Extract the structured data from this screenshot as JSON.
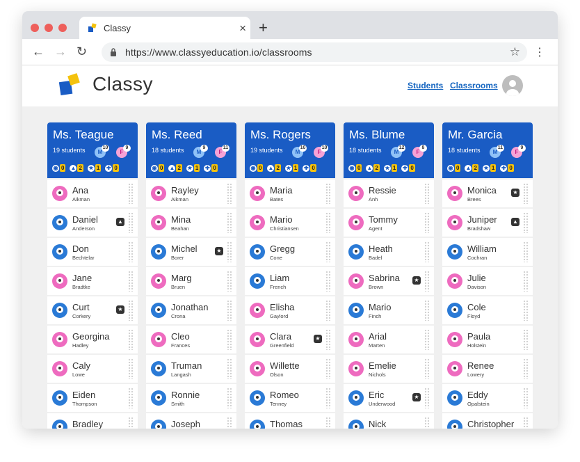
{
  "browser": {
    "tab_title": "Classy",
    "tab_close": "×",
    "new_tab": "+",
    "url": "https://www.classyeducation.io/classrooms",
    "back": "←",
    "forward": "→",
    "reload": "↻",
    "bookmark": "☆",
    "menu": "⋮",
    "traffic_colors": [
      "#ee5f5b",
      "#ee5f5b",
      "#ee5f5b"
    ]
  },
  "app": {
    "brand": "Classy",
    "nav": {
      "students": "Students",
      "classrooms": "Classrooms"
    },
    "logo_colors": {
      "blue": "#1a5cc4",
      "yellow": "#f4c20d"
    }
  },
  "stat_icons": [
    "◉",
    "▲",
    "★",
    "✚"
  ],
  "columns": [
    {
      "title": "Ms. Teague",
      "count": "19 students",
      "m": "10",
      "f": "9",
      "stats": [
        "0",
        "2",
        "1",
        "0"
      ],
      "students": [
        {
          "first": "Ana",
          "last": "Aikman",
          "gender": "f",
          "mark": ""
        },
        {
          "first": "Daniel",
          "last": "Anderson",
          "gender": "m",
          "mark": "▲"
        },
        {
          "first": "Don",
          "last": "Bechtelar",
          "gender": "m",
          "mark": ""
        },
        {
          "first": "Jane",
          "last": "Bradtke",
          "gender": "f",
          "mark": ""
        },
        {
          "first": "Curt",
          "last": "Corkery",
          "gender": "m",
          "mark": "★"
        },
        {
          "first": "Georgina",
          "last": "Hadley",
          "gender": "f",
          "mark": ""
        },
        {
          "first": "Caly",
          "last": "Lowe",
          "gender": "f",
          "mark": ""
        },
        {
          "first": "Eiden",
          "last": "Thompson",
          "gender": "m",
          "mark": ""
        },
        {
          "first": "Bradley",
          "last": "",
          "gender": "m",
          "mark": ""
        }
      ]
    },
    {
      "title": "Ms. Reed",
      "count": "18 students",
      "m": "9",
      "f": "11",
      "stats": [
        "0",
        "2",
        "1",
        "0"
      ],
      "students": [
        {
          "first": "Rayley",
          "last": "Aikman",
          "gender": "f",
          "mark": ""
        },
        {
          "first": "Mina",
          "last": "Beahan",
          "gender": "f",
          "mark": ""
        },
        {
          "first": "Michel",
          "last": "Borer",
          "gender": "m",
          "mark": "★"
        },
        {
          "first": "Marg",
          "last": "Bruen",
          "gender": "f",
          "mark": ""
        },
        {
          "first": "Jonathan",
          "last": "Crona",
          "gender": "m",
          "mark": ""
        },
        {
          "first": "Cleo",
          "last": "Frances",
          "gender": "f",
          "mark": ""
        },
        {
          "first": "Truman",
          "last": "Langash",
          "gender": "m",
          "mark": ""
        },
        {
          "first": "Ronnie",
          "last": "Smith",
          "gender": "m",
          "mark": ""
        },
        {
          "first": "Joseph",
          "last": "",
          "gender": "m",
          "mark": ""
        }
      ]
    },
    {
      "title": "Ms. Rogers",
      "count": "19 students",
      "m": "10",
      "f": "10",
      "stats": [
        "0",
        "2",
        "1",
        "0"
      ],
      "students": [
        {
          "first": "Maria",
          "last": "Bates",
          "gender": "f",
          "mark": ""
        },
        {
          "first": "Mario",
          "last": "Christiansen",
          "gender": "f",
          "mark": ""
        },
        {
          "first": "Gregg",
          "last": "Cone",
          "gender": "m",
          "mark": ""
        },
        {
          "first": "Liam",
          "last": "French",
          "gender": "m",
          "mark": ""
        },
        {
          "first": "Elisha",
          "last": "Gaylord",
          "gender": "f",
          "mark": ""
        },
        {
          "first": "Clara",
          "last": "Greenfield",
          "gender": "f",
          "mark": "★"
        },
        {
          "first": "Willette",
          "last": "Olson",
          "gender": "f",
          "mark": ""
        },
        {
          "first": "Romeo",
          "last": "Tenney",
          "gender": "m",
          "mark": ""
        },
        {
          "first": "Thomas",
          "last": "",
          "gender": "m",
          "mark": ""
        }
      ]
    },
    {
      "title": "Ms. Blume",
      "count": "18 students",
      "m": "12",
      "f": "8",
      "stats": [
        "0",
        "2",
        "1",
        "0"
      ],
      "students": [
        {
          "first": "Ressie",
          "last": "Anh",
          "gender": "f",
          "mark": ""
        },
        {
          "first": "Tommy",
          "last": "Agent",
          "gender": "f",
          "mark": ""
        },
        {
          "first": "Heath",
          "last": "Badel",
          "gender": "m",
          "mark": ""
        },
        {
          "first": "Sabrina",
          "last": "Brown",
          "gender": "f",
          "mark": "★"
        },
        {
          "first": "Mario",
          "last": "Finch",
          "gender": "m",
          "mark": ""
        },
        {
          "first": "Arial",
          "last": "Marten",
          "gender": "f",
          "mark": ""
        },
        {
          "first": "Emelie",
          "last": "Nichols",
          "gender": "f",
          "mark": ""
        },
        {
          "first": "Eric",
          "last": "Underwood",
          "gender": "m",
          "mark": "★"
        },
        {
          "first": "Nick",
          "last": "",
          "gender": "m",
          "mark": ""
        }
      ]
    },
    {
      "title": "Mr. Garcia",
      "count": "18 students",
      "m": "11",
      "f": "9",
      "stats": [
        "0",
        "2",
        "1",
        "0"
      ],
      "students": [
        {
          "first": "Monica",
          "last": "Brees",
          "gender": "f",
          "mark": "★"
        },
        {
          "first": "Juniper",
          "last": "Bradshaw",
          "gender": "f",
          "mark": "▲"
        },
        {
          "first": "William",
          "last": "Cochran",
          "gender": "m",
          "mark": ""
        },
        {
          "first": "Julie",
          "last": "Davison",
          "gender": "f",
          "mark": ""
        },
        {
          "first": "Cole",
          "last": "Floyd",
          "gender": "m",
          "mark": ""
        },
        {
          "first": "Paula",
          "last": "Holstein",
          "gender": "f",
          "mark": ""
        },
        {
          "first": "Renee",
          "last": "Lowery",
          "gender": "f",
          "mark": ""
        },
        {
          "first": "Eddy",
          "last": "Opalstein",
          "gender": "m",
          "mark": ""
        },
        {
          "first": "Christopher",
          "last": "",
          "gender": "m",
          "mark": ""
        }
      ]
    }
  ]
}
